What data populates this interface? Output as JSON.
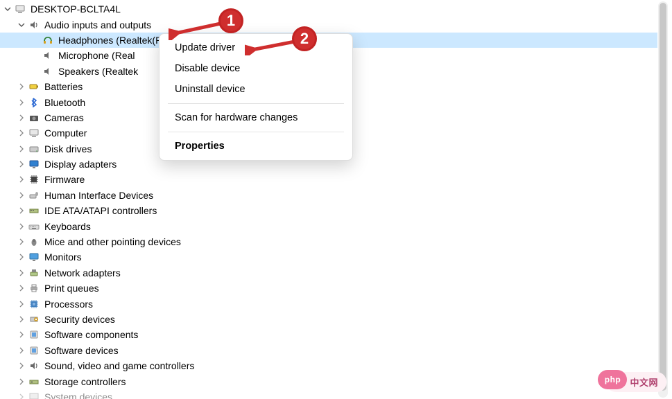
{
  "root": {
    "label": "DESKTOP-BCLTA4L"
  },
  "audio": {
    "label": "Audio inputs and outputs",
    "children": {
      "headphones": "Headphones (Realtek(R) Audio)",
      "microphone": "Microphone (Real",
      "speakers": "Speakers (Realtek"
    }
  },
  "categories": {
    "batteries": "Batteries",
    "bluetooth": "Bluetooth",
    "cameras": "Cameras",
    "computer": "Computer",
    "disk_drives": "Disk drives",
    "display_adapters": "Display adapters",
    "firmware": "Firmware",
    "hid": "Human Interface Devices",
    "ide": "IDE ATA/ATAPI controllers",
    "keyboards": "Keyboards",
    "mice": "Mice and other pointing devices",
    "monitors": "Monitors",
    "network": "Network adapters",
    "print_queues": "Print queues",
    "processors": "Processors",
    "security": "Security devices",
    "sw_components": "Software components",
    "sw_devices": "Software devices",
    "sound": "Sound, video and game controllers",
    "storage": "Storage controllers",
    "system": "System devices"
  },
  "menu": {
    "update": "Update driver",
    "disable": "Disable device",
    "uninstall": "Uninstall device",
    "scan": "Scan for hardware changes",
    "properties": "Properties"
  },
  "annotations": {
    "badge1": "1",
    "badge2": "2"
  },
  "watermark": {
    "tag": "php",
    "text": "中文网"
  }
}
